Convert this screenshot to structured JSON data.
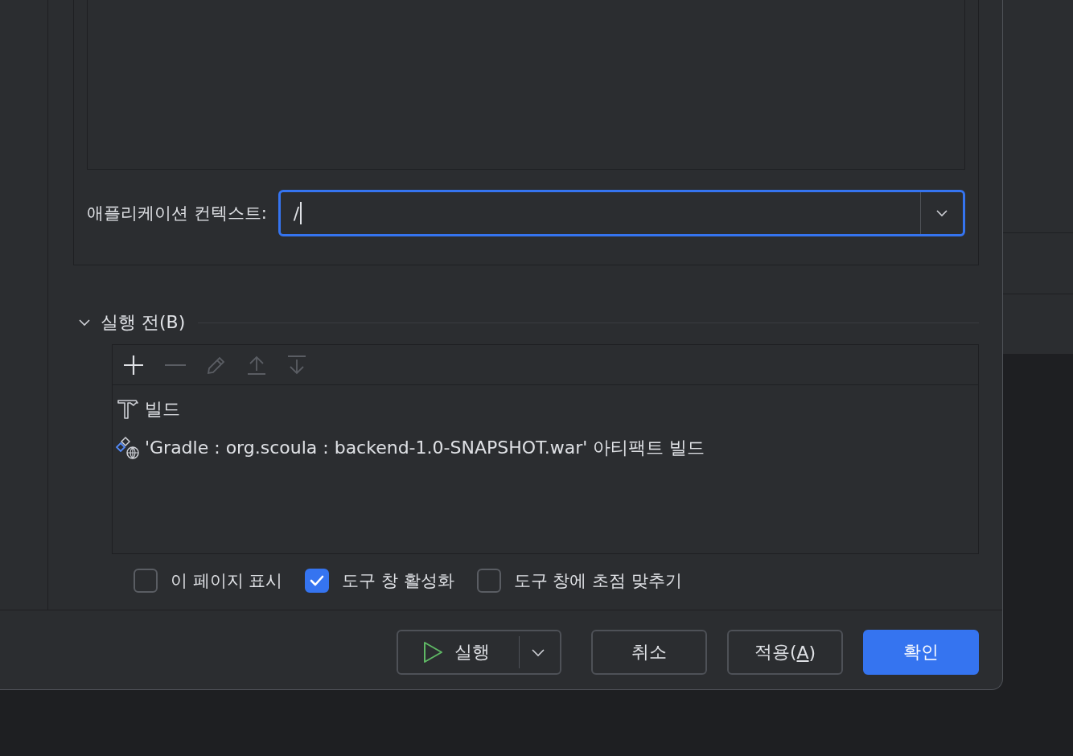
{
  "context_field": {
    "label": "애플리케이션 컨텍스트:",
    "value": "/"
  },
  "before_launch": {
    "title": "실행 전(B)",
    "expanded": true,
    "toolbar": [
      {
        "kind": "add",
        "disabled": false
      },
      {
        "kind": "remove",
        "disabled": true
      },
      {
        "kind": "edit",
        "disabled": true
      },
      {
        "kind": "up",
        "disabled": true
      },
      {
        "kind": "down",
        "disabled": true
      }
    ],
    "tasks": [
      {
        "kind": "build",
        "text": "빌드"
      },
      {
        "kind": "artifact",
        "text": "'Gradle : org.scoula : backend-1.0-SNAPSHOT.war' 아티팩트 빌드"
      }
    ]
  },
  "options": [
    {
      "label": "이 페이지 표시",
      "checked": false
    },
    {
      "label": "도구 창 활성화",
      "checked": true
    },
    {
      "label": "도구 창에 초점 맞추기",
      "checked": false
    }
  ],
  "buttons": [
    {
      "kind": "run",
      "label": "실행"
    },
    {
      "kind": "cancel",
      "label": "취소"
    },
    {
      "kind": "apply",
      "label": "적용(",
      "mnemonic": "A",
      "label_end": ")"
    },
    {
      "kind": "ok",
      "label": "확인"
    }
  ]
}
